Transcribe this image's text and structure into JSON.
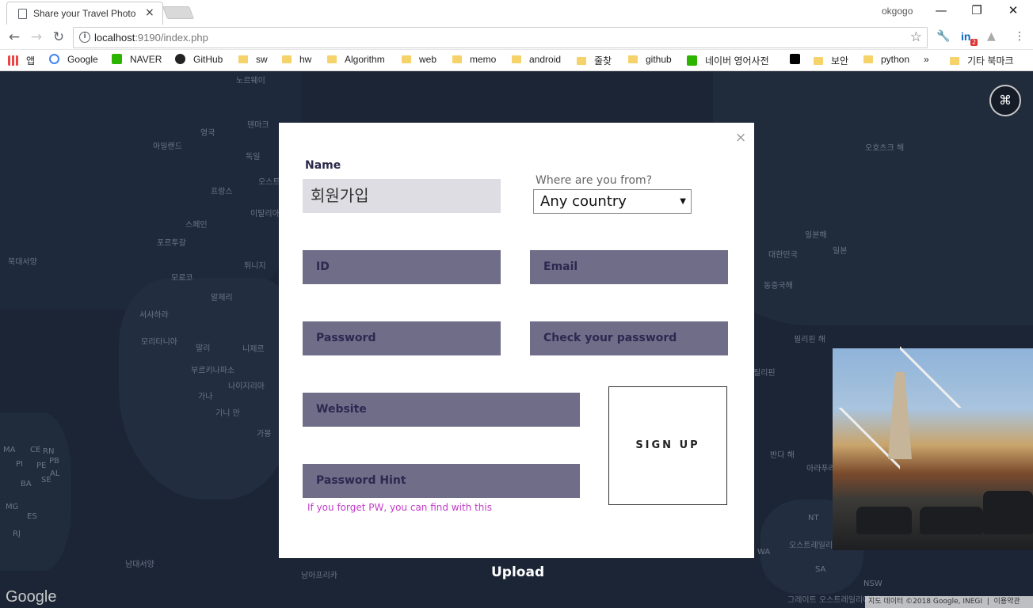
{
  "browser": {
    "tab_title": "Share your Travel Photo",
    "tab_close": "×",
    "profile_name": "okgogo",
    "url_host": "localhost",
    "url_rest": ":9190/index.php",
    "info_icon": "ⓘ",
    "star_icon": "☆",
    "linkedin_badge": "2",
    "bookmarks": [
      {
        "label": "앱",
        "icon": "apps-grid"
      },
      {
        "label": "Google",
        "icon": "google"
      },
      {
        "label": "NAVER",
        "icon": "naver"
      },
      {
        "label": "GitHub",
        "icon": "github"
      },
      {
        "label": "sw",
        "icon": "folder"
      },
      {
        "label": "hw",
        "icon": "folder"
      },
      {
        "label": "Algorithm",
        "icon": "folder"
      },
      {
        "label": "web",
        "icon": "folder"
      },
      {
        "label": "memo",
        "icon": "folder"
      },
      {
        "label": "android",
        "icon": "folder"
      },
      {
        "label": "줄찾",
        "icon": "folder"
      },
      {
        "label": "github",
        "icon": "folder"
      },
      {
        "label": "네이버 영어사전",
        "icon": "naver-dict"
      },
      {
        "label": "",
        "icon": "jetbrains"
      },
      {
        "label": "보안",
        "icon": "folder"
      },
      {
        "label": "python",
        "icon": "folder"
      }
    ],
    "bookmarks_more": "»",
    "other_bookmarks": "기타 북마크"
  },
  "map": {
    "labels": [
      "노르웨이",
      "아일랜드",
      "영국",
      "덴마크",
      "독일",
      "오스트",
      "프랑스",
      "이탈리아",
      "스페인",
      "포르투갈",
      "북대서양",
      "모로코",
      "튀니지",
      "알제리",
      "서사하라",
      "모리타니아",
      "말리",
      "니제르",
      "부르키나파소",
      "가나",
      "나이지리아",
      "기니 만",
      "가봉",
      "남대서양",
      "남아프리카",
      "대한민국",
      "일본",
      "일본해",
      "동중국해",
      "필리핀 해",
      "필리핀",
      "반다 해",
      "아라푸라",
      "오스트레일리",
      "그레이트 오스트레일리아 만",
      "오호츠크 해",
      "MA",
      "PI",
      "CE",
      "RN",
      "PB",
      "PE",
      "AL",
      "BA",
      "SE",
      "MG",
      "ES",
      "RJ",
      "NT",
      "WA",
      "SA",
      "NSW"
    ],
    "google": "Google",
    "attribution": "지도 데이터 ©2018 Google, INEGI",
    "terms": "이용약관"
  },
  "upload_label": "Upload",
  "modal": {
    "close": "×",
    "name_label": "Name",
    "name_value": "회원가입",
    "country_label": "Where are you from?",
    "country_selected": "Any country",
    "fields": {
      "id": "ID",
      "email": "Email",
      "password": "Password",
      "check_password": "Check your password",
      "website": "Website",
      "password_hint": "Password Hint"
    },
    "hint_text": "If you forget PW, you can find with this",
    "signup": "SIGN UP"
  }
}
